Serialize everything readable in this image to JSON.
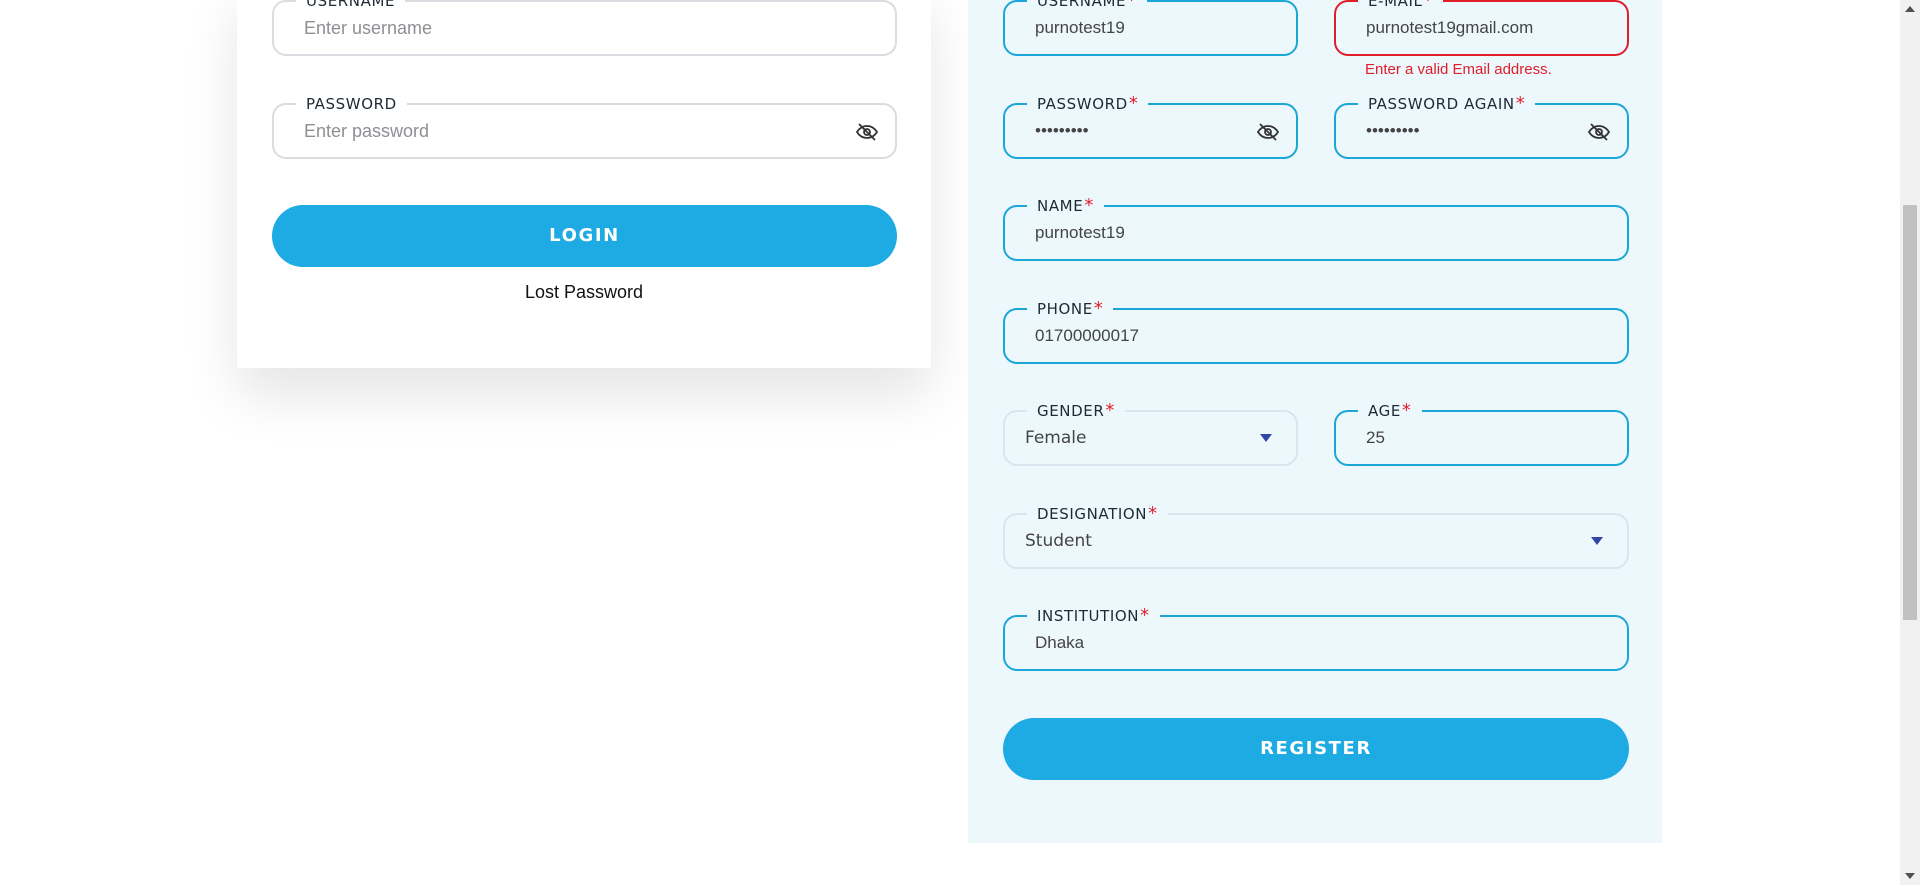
{
  "login": {
    "username_label": "USERNAME",
    "username_placeholder": "Enter username",
    "password_label": "PASSWORD",
    "password_placeholder": "Enter password",
    "login_button": "LOGIN",
    "lost_password": "Lost Password"
  },
  "register": {
    "username_label": "USERNAME",
    "username_value": "purnotest19",
    "email_label": "E-MAIL",
    "email_value": "purnotest19gmail.com",
    "email_error": "Enter a valid Email address.",
    "password_label": "PASSWORD",
    "password_value": "•••••••••",
    "password_again_label": "PASSWORD AGAIN",
    "password_again_value": "•••••••••",
    "name_label": "NAME",
    "name_value": "purnotest19",
    "phone_label": "PHONE",
    "phone_value": "01700000017",
    "gender_label": "GENDER",
    "gender_value": "Female",
    "age_label": "AGE",
    "age_value": "25",
    "designation_label": "DESIGNATION",
    "designation_value": "Student",
    "institution_label": "INSTITUTION",
    "institution_value": "Dhaka",
    "register_button": "REGISTER",
    "required_mark": "*"
  },
  "colors": {
    "accent": "#1eaae2",
    "error": "#e01e2a",
    "panel_bg": "#edf8fd",
    "field_border": "#1aa6d6"
  },
  "icons": {
    "eye": "eye-off-icon",
    "dropdown": "chevron-down-icon"
  }
}
